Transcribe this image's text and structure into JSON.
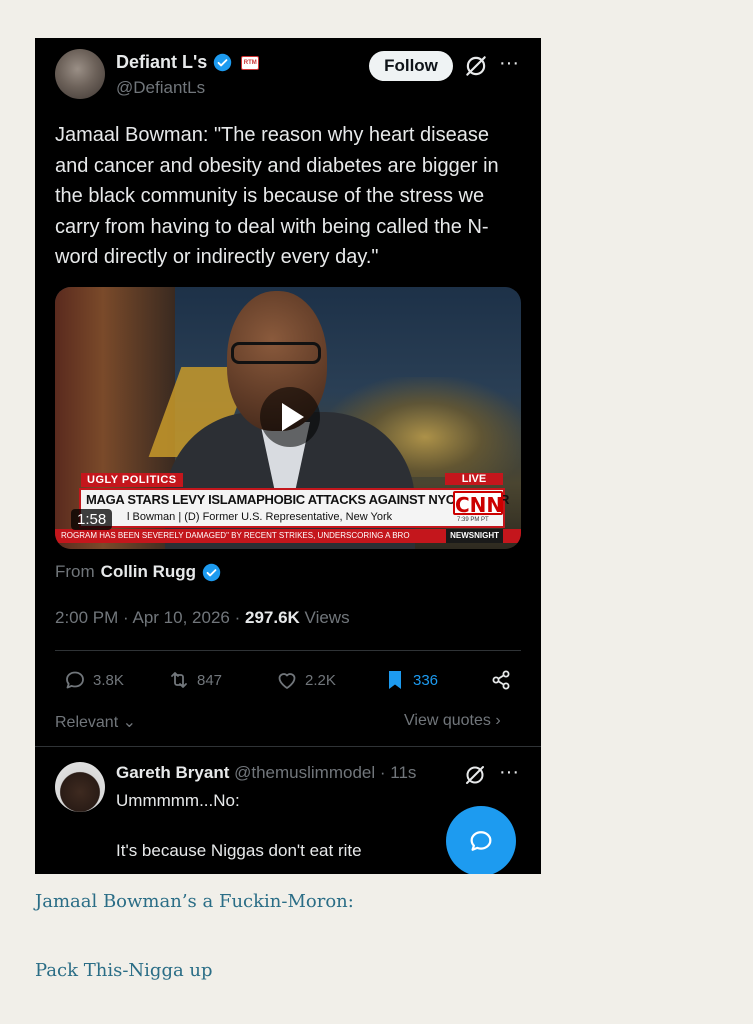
{
  "post": {
    "author_name": "Defiant L's",
    "handle": "@DefiantLs",
    "follow_label": "Follow",
    "badge_text": "RTM",
    "text": "Jamaal Bowman: \"The reason why heart disease and cancer and obesity and diabetes are bigger in the black community is because of the stress we carry from having to deal with being called the N-word directly or indirectly every day.\"",
    "video": {
      "duration": "1:58",
      "chyron_tag": "UGLY POLITICS",
      "live_tag": "LIVE",
      "headline": "MAGA STARS LEVY ISLAMAPHOBIC ATTACKS AGAINST NYC WINNER",
      "subline": "l Bowman  |  (D) Former U.S. Representative, New York",
      "network": "CNN",
      "network_time": "7:39 PM PT",
      "ticker": "ROGRAM HAS BEEN SEVERELY DAMAGED\" BY RECENT STRIKES, UNDERSCORING A BRO",
      "show": "NEWSNIGHT"
    },
    "from_label": "From",
    "from_name": "Collin Rugg",
    "time": "2:00 PM",
    "date": "Apr 10, 2026",
    "views_count": "297.6K",
    "views_label": "Views",
    "actions": {
      "replies": "3.8K",
      "reposts": "847",
      "likes": "2.2K",
      "bookmarks": "336"
    },
    "sort_label": "Relevant",
    "view_quotes_label": "View quotes"
  },
  "reply": {
    "author_name": "Gareth Bryant",
    "handle": "@themuslimmodel",
    "time": "11s",
    "line1": "Ummmmm...No:",
    "line2": "It's because Niggas don't eat rite"
  },
  "captions": {
    "line1": "Jamaal Bowman’s a Fuckin-Moron:",
    "line2": "Pack This-Nigga up"
  },
  "colors": {
    "accent": "#1d9bf0",
    "card_bg": "#000000",
    "page_bg": "#f1efe9",
    "caption": "#2a6d86"
  }
}
